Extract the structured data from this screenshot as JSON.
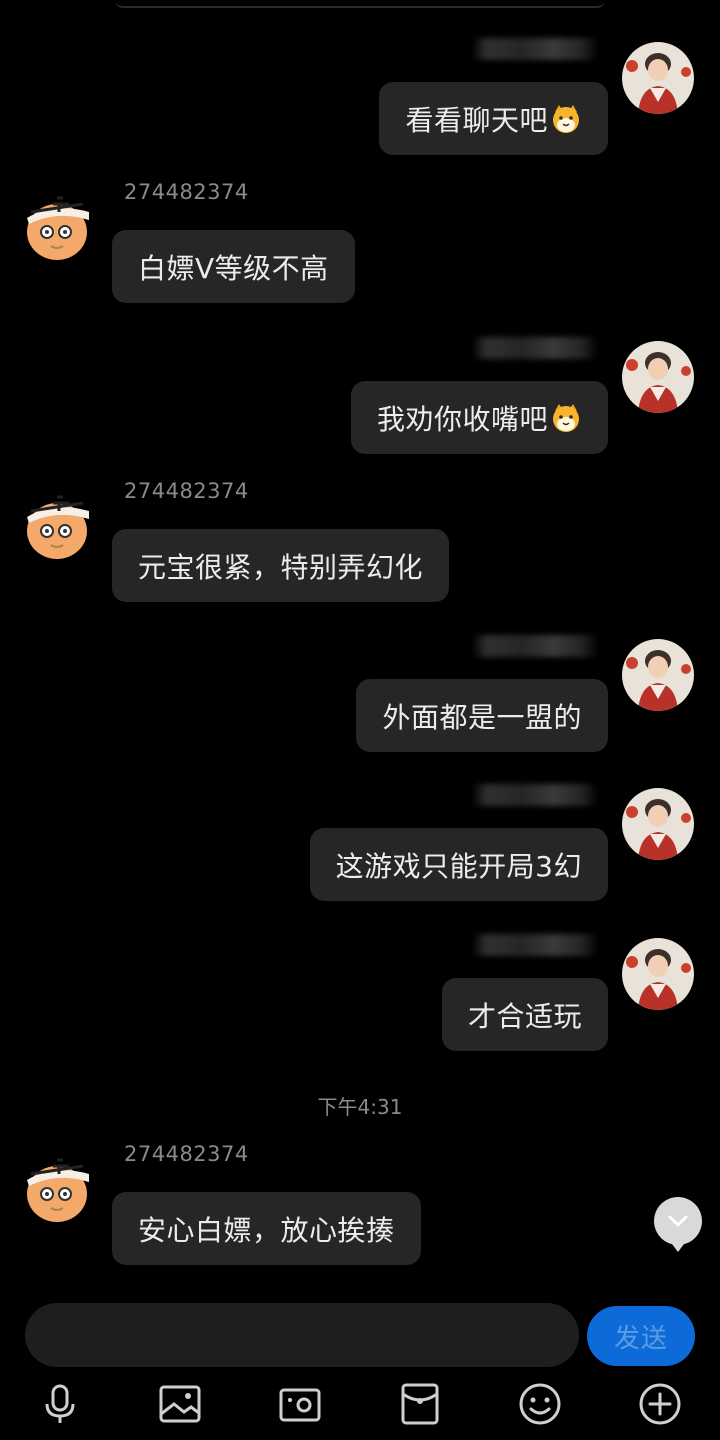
{
  "chat": {
    "messages": [
      {
        "direction": "outgoing",
        "text": "看看聊天吧",
        "emoji": "cat-face"
      },
      {
        "direction": "incoming",
        "sender": "274482374",
        "text": "白嫖V等级不高"
      },
      {
        "direction": "outgoing",
        "text": "我劝你收嘴吧",
        "emoji": "cat-face"
      },
      {
        "direction": "incoming",
        "sender": "274482374",
        "text": "元宝很紧，特别弄幻化"
      },
      {
        "direction": "outgoing",
        "text": "外面都是一盟的"
      },
      {
        "direction": "outgoing",
        "text": "这游戏只能开局3幻"
      },
      {
        "direction": "outgoing",
        "text": "才合适玩"
      },
      {
        "direction": "incoming",
        "sender": "274482374",
        "text": "安心白嫖，放心挨揍"
      }
    ],
    "timestamp": "下午4:31"
  },
  "composer": {
    "input_value": "",
    "send_label": "发送"
  },
  "toolbar": {
    "icons": [
      "microphone-icon",
      "image-icon",
      "camera-icon",
      "red-packet-icon",
      "emoji-icon",
      "plus-icon"
    ]
  },
  "colors": {
    "background": "#000000",
    "bubble": "#262626",
    "send_button": "#0d6bd9",
    "meta_text": "#8a8a8a"
  }
}
